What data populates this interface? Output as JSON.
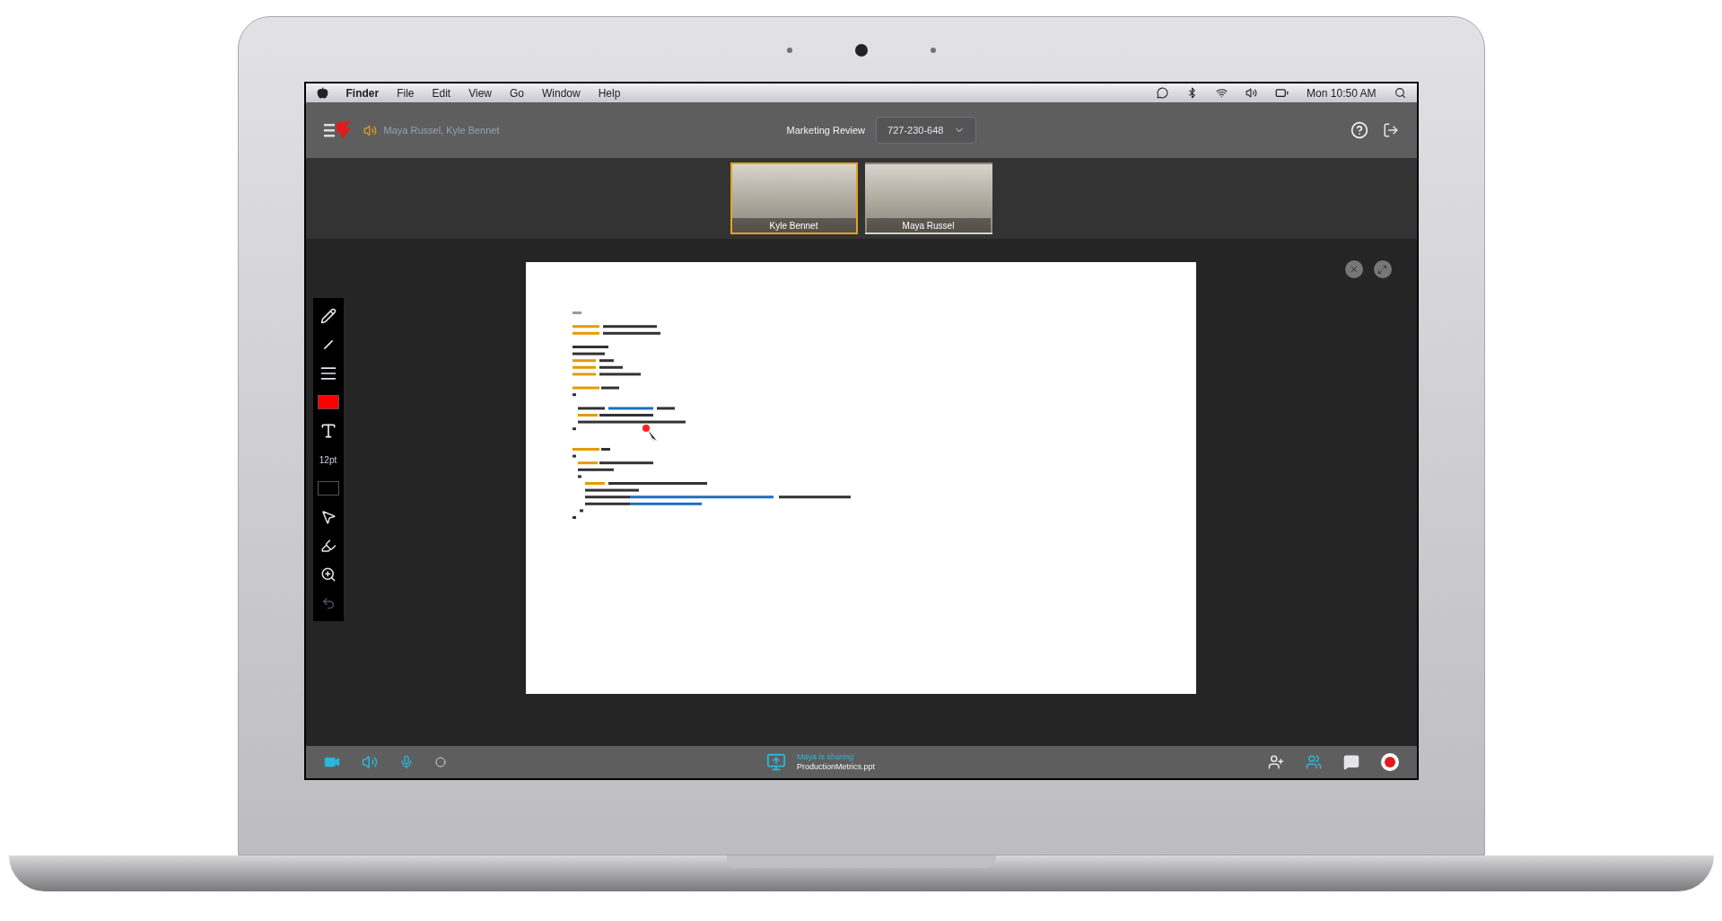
{
  "menu_bar": {
    "app": "Finder",
    "items": [
      "File",
      "Edit",
      "View",
      "Go",
      "Window",
      "Help"
    ],
    "clock": "Mon 10:50 AM"
  },
  "header": {
    "participants": "Maya Russel, Kyle Bennet",
    "meeting_title": "Marketing Review",
    "meeting_id": "727-230-648"
  },
  "videos": [
    {
      "name": "Kyle Bennet",
      "selected": true
    },
    {
      "name": "Maya Russel",
      "selected": false
    }
  ],
  "tools": [
    {
      "kind": "pen"
    },
    {
      "kind": "line"
    },
    {
      "kind": "stroke"
    },
    {
      "kind": "color",
      "color": "#ff0000"
    },
    {
      "kind": "text"
    },
    {
      "kind": "size",
      "label": "12pt"
    },
    {
      "kind": "color",
      "color": "#000000"
    },
    {
      "kind": "pointer"
    },
    {
      "kind": "marker"
    },
    {
      "kind": "zoom"
    },
    {
      "kind": "undo"
    }
  ],
  "sharing": {
    "status": "Maya is sharing",
    "file": "ProductionMetrics.ppt"
  }
}
